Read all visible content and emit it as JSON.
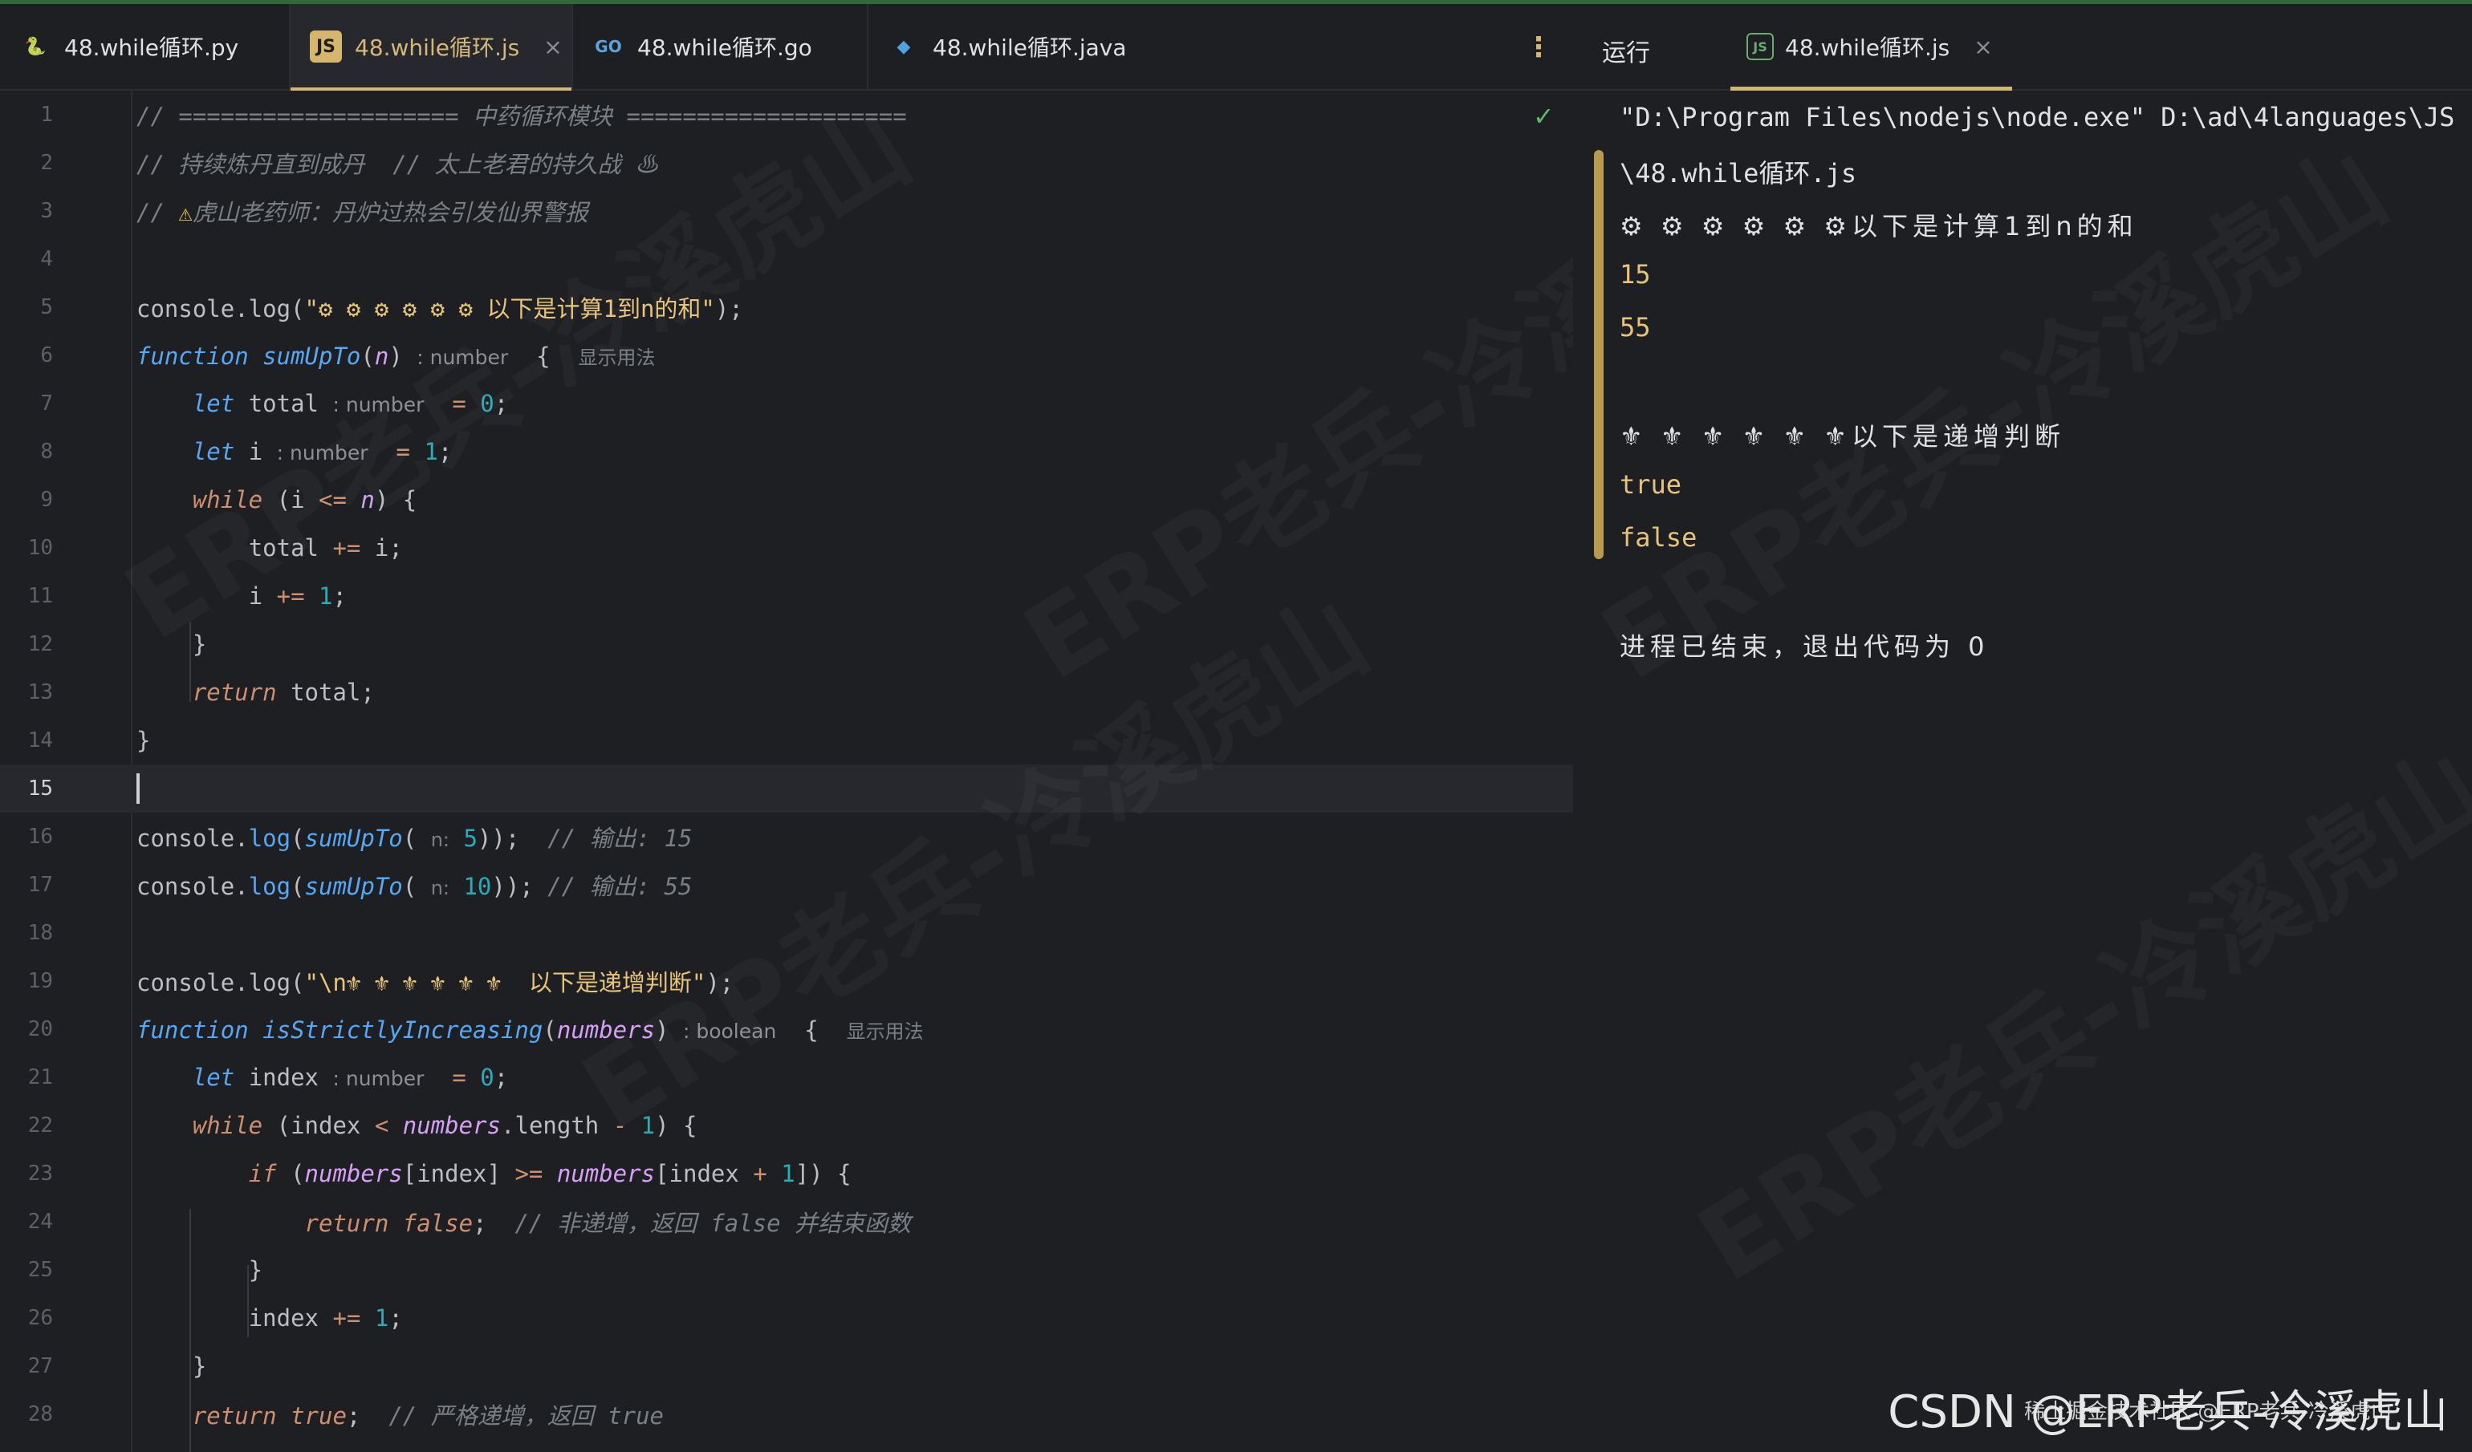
{
  "tabs": [
    {
      "label": "48.while循环.py",
      "icon": "python-icon"
    },
    {
      "label": "48.while循环.js",
      "icon": "js-file-icon",
      "active": true
    },
    {
      "label": "48.while循环.go",
      "icon": "go-icon"
    },
    {
      "label": "48.while循环.java",
      "icon": "java-icon"
    }
  ],
  "run_panel": {
    "label": "运行",
    "tab_label": "48.while循环.js",
    "tab_icon_text": "JS"
  },
  "icons": {
    "close": "×",
    "more": "⋮",
    "check": "✓"
  },
  "editor": {
    "current_line": 15,
    "line_numbers": [
      "1",
      "2",
      "3",
      "4",
      "5",
      "6",
      "7",
      "8",
      "9",
      "10",
      "11",
      "12",
      "13",
      "14",
      "15",
      "16",
      "17",
      "18",
      "19",
      "20",
      "21",
      "22",
      "23",
      "24",
      "25",
      "26",
      "27",
      "28"
    ],
    "line1": "// ==================== 中药循环模块 ====================",
    "line2": "// 持续炼丹直到成丹  // 太上老君的持久战 ♨",
    "line3_prefix": "// ",
    "line3_warn": "⚠",
    "line3_text": "虎山老药师：丹炉过热会引发仙界警报",
    "line5_a": "console",
    "line5_b": ".log(",
    "line5_str": "\"⚙ ⚙ ⚙ ⚙ ⚙ ⚙ 以下是计算1到n的和\"",
    "line5_c": ");",
    "kw_function": "function",
    "fn_sum": "sumUpTo",
    "param_n": "n",
    "hint_number": ": number",
    "hint_boolean": ": boolean",
    "usage": "显示用法",
    "kw_let": "let",
    "var_total": "total",
    "var_i": "i",
    "var_index": "index",
    "kw_while": "while",
    "kw_return": "return",
    "kw_if": "if",
    "val_false": "false",
    "val_true": "true",
    "hint_n": "n:",
    "line16_comment": "// 输出: 15",
    "line17_comment": "// 输出: 55",
    "line19_str": "\"\\n⚜ ⚜ ⚜ ⚜ ⚜ ⚜  以下是递增判断\"",
    "fn_inc": "isStrictlyIncreasing",
    "param_numbers": "numbers",
    "prop_length": "length",
    "line24_comment": "// 非递增，返回 false 并结束函数",
    "line28_comment": "// 严格递增，返回 true",
    "num_0": "0",
    "num_1": "1",
    "num_5": "5",
    "num_10": "10"
  },
  "console": {
    "lines": [
      "\"D:\\Program Files\\nodejs\\node.exe\" D:\\ad\\4languages\\JS",
      "\\48.while循环.js",
      "⚙ ⚙ ⚙ ⚙ ⚙ ⚙以下是计算1到n的和",
      "15",
      "55",
      "",
      "⚜ ⚜ ⚜ ⚜ ⚜ ⚜以下是递增判断",
      "true",
      "false",
      "",
      "进程已结束，退出代码为 0"
    ]
  },
  "watermark": "ERP老兵-冷溪虎山",
  "footer": {
    "csdn": "CSDN @ERP老兵-冷溪虎山",
    "sub": "稀土掘金技术社区 @ERP老兵-冷溪虎山"
  },
  "colors": {
    "background": "#1e1f22",
    "accent": "#d6b56d",
    "keyword": "#cf8e6d",
    "function": "#56a8f5",
    "number": "#2aacb8",
    "param": "#d5a0f5",
    "comment": "#7a7e85"
  }
}
